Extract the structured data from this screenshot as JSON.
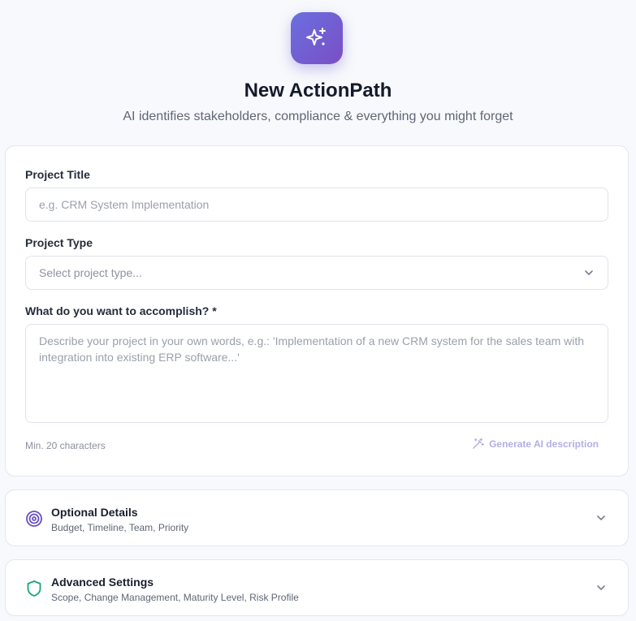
{
  "header": {
    "logo_icon": "sparkles-icon",
    "title": "New ActionPath",
    "subtitle": "AI identifies stakeholders, compliance & everything you might forget"
  },
  "form": {
    "project_title": {
      "label": "Project Title",
      "placeholder": "e.g. CRM System Implementation",
      "value": ""
    },
    "project_type": {
      "label": "Project Type",
      "placeholder": "Select project type...",
      "icon": "chevron-down-icon"
    },
    "goal": {
      "label": "What do you want to accomplish? *",
      "placeholder": "Describe your project in your own words, e.g.: 'Implementation of a new CRM system for the sales team with integration into existing ERP software...'",
      "value": "",
      "hint": "Min. 20 characters"
    },
    "generate_button": {
      "label": "Generate AI description",
      "icon": "magic-wand-icon"
    }
  },
  "accordions": [
    {
      "title": "Optional Details",
      "subtitle": "Budget, Timeline, Team, Priority",
      "icon": "target-icon",
      "icon_color": "#6b4fc4"
    },
    {
      "title": "Advanced Settings",
      "subtitle": "Scope, Change Management, Maturity Level, Risk Profile",
      "icon": "shield-icon",
      "icon_color": "#1aa37a"
    }
  ],
  "colors": {
    "accent_gradient_start": "#6a6fe0",
    "accent_gradient_end": "#7a4fc4",
    "generate_button": "#b3aee6"
  }
}
